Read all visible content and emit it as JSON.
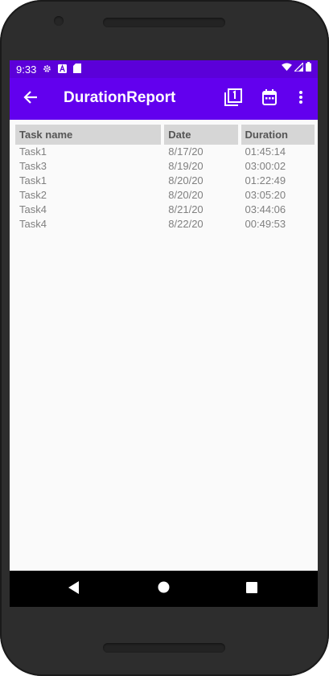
{
  "status": {
    "time": "9:33",
    "left_icons": [
      "gear-icon",
      "a-icon",
      "sdcard-icon"
    ],
    "right_icons": [
      "wifi-icon",
      "signal-icon",
      "battery-icon"
    ]
  },
  "appbar": {
    "title": "DurationReport",
    "back_icon": "arrow-back-icon",
    "actions": [
      "filter-one-icon",
      "calendar-icon",
      "more-vert-icon"
    ]
  },
  "table": {
    "headers": [
      "Task name",
      "Date",
      "Duration"
    ],
    "rows": [
      [
        "Task1",
        "8/17/20",
        "01:45:14"
      ],
      [
        "Task3",
        "8/19/20",
        "03:00:02"
      ],
      [
        "Task1",
        "8/20/20",
        "01:22:49"
      ],
      [
        "Task2",
        "8/20/20",
        "03:05:20"
      ],
      [
        "Task4",
        "8/21/20",
        "03:44:06"
      ],
      [
        "Task4",
        "8/22/20",
        "00:49:53"
      ]
    ]
  },
  "colors": {
    "appbar": "#6200ee",
    "statusbar": "#5b00d9",
    "header_bg": "#d6d6d6"
  },
  "navbar": {
    "icons": [
      "back-triangle-icon",
      "home-circle-icon",
      "recents-square-icon"
    ]
  }
}
